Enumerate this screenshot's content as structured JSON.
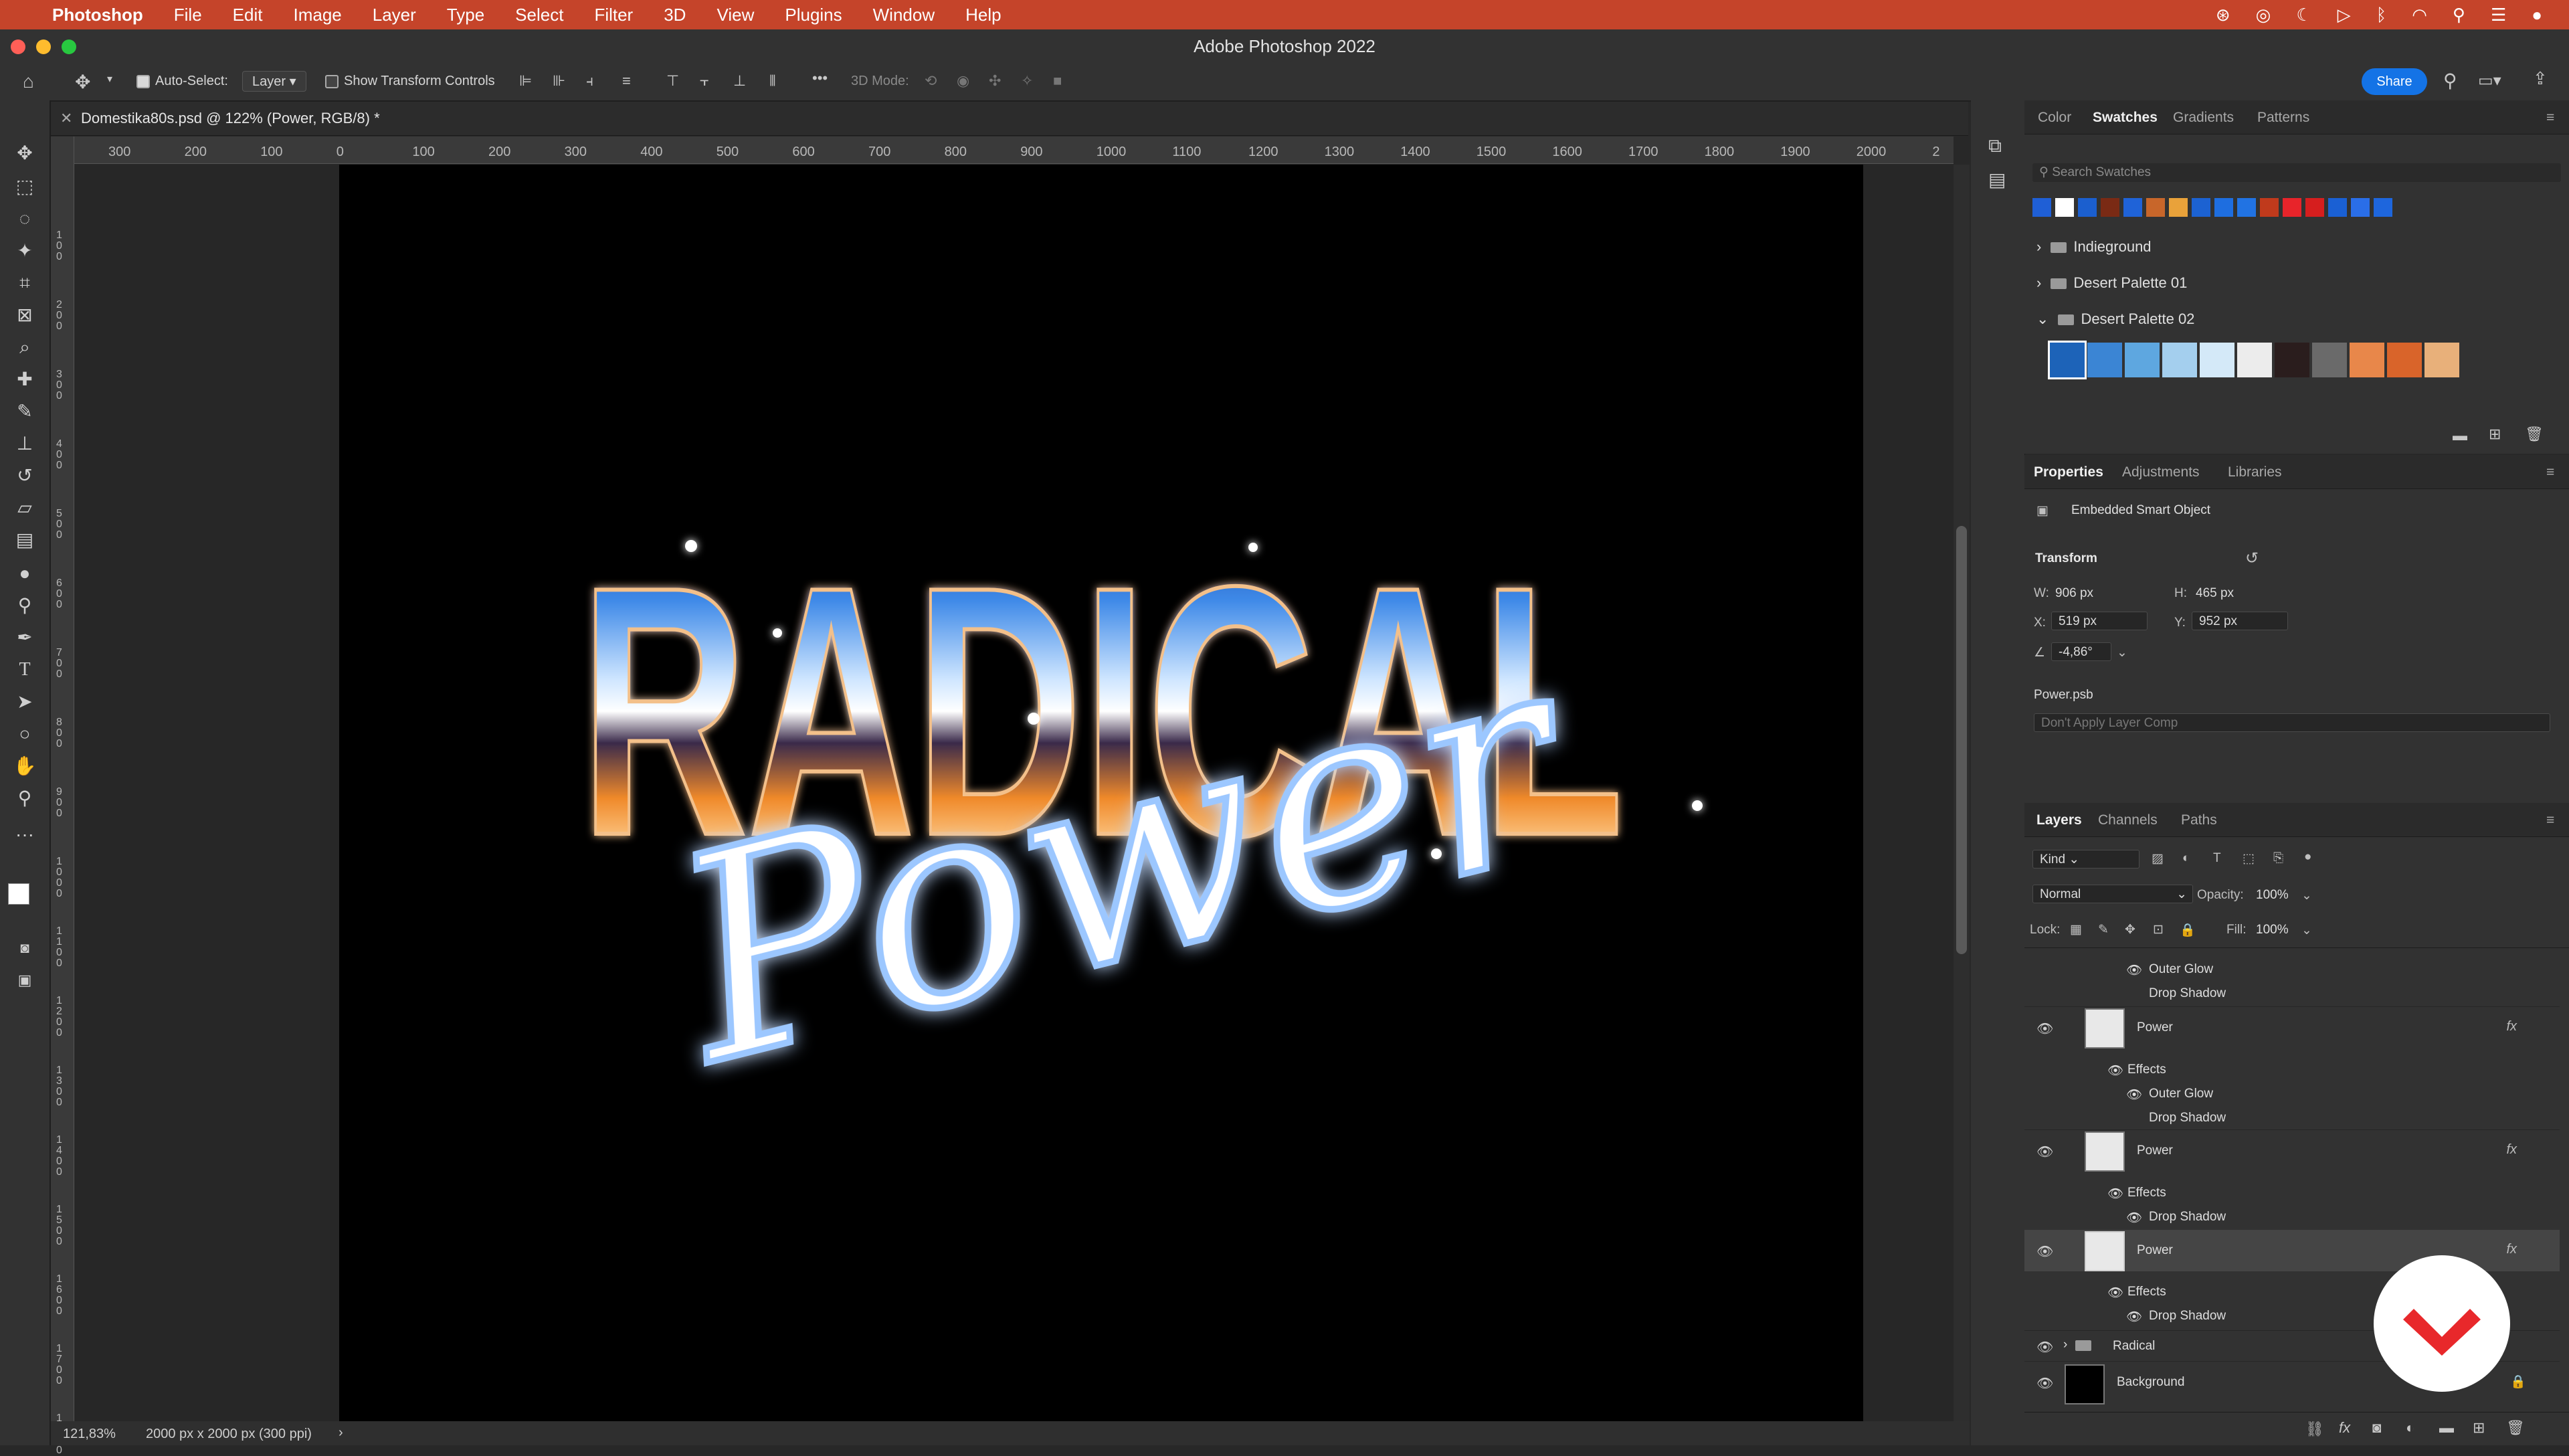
{
  "menubar": {
    "app_name": "Photoshop",
    "items": [
      "File",
      "Edit",
      "Image",
      "Layer",
      "Type",
      "Select",
      "Filter",
      "3D",
      "View",
      "Plugins",
      "Window",
      "Help"
    ]
  },
  "window": {
    "title": "Adobe Photoshop 2022"
  },
  "options_bar": {
    "auto_select_label": "Auto-Select:",
    "auto_select_value": "Layer",
    "transform_label": "Show Transform Controls",
    "mode_label": "3D Mode:",
    "share_label": "Share"
  },
  "document": {
    "tab_title": "Domestika80s.psd @ 122% (Power, RGB/8) *",
    "zoom": "121,83%",
    "doc_info": "2000 px x 2000 px (300 ppi)"
  },
  "rulers": {
    "horizontal": [
      "300",
      "200",
      "100",
      "0",
      "100",
      "200",
      "300",
      "400",
      "500",
      "600",
      "700",
      "800",
      "900",
      "1000",
      "1100",
      "1200",
      "1300",
      "1400",
      "1500",
      "1600",
      "1700",
      "1800",
      "1900",
      "2000",
      "2"
    ],
    "vertical": [
      "1\n0\n0",
      "2\n0\n0",
      "3\n0\n0",
      "4\n0\n0",
      "5\n0\n0",
      "6\n0\n0",
      "7\n0\n0",
      "8\n0\n0",
      "9\n0\n0",
      "1\n0\n0\n0",
      "1\n1\n0\n0",
      "1\n2\n0\n0",
      "1\n3\n0\n0",
      "1\n4\n0\n0",
      "1\n5\n0\n0",
      "1\n6\n0\n0",
      "1\n7\n0\n0",
      "1\n8\n0\n0"
    ]
  },
  "artwork": {
    "title_text": "RADICAL",
    "script_text": "Power"
  },
  "swatches_panel": {
    "tabs": [
      "Color",
      "Swatches",
      "Gradients",
      "Patterns"
    ],
    "active_tab": "Swatches",
    "search_placeholder": "Search Swatches",
    "recent_colors": [
      "#1f5fd6",
      "#ffffff",
      "#1b5fcf",
      "#7a2a14",
      "#1f63d8",
      "#c8662a",
      "#e9a23a",
      "#1c62d2",
      "#1e6ee0",
      "#2173e3",
      "#c03a1c",
      "#e8242a",
      "#d61e1e",
      "#1a60d4",
      "#2a6ee8",
      "#1e66dd"
    ],
    "folders": [
      {
        "name": "Indieground",
        "expanded": false
      },
      {
        "name": "Desert Palette 01",
        "expanded": false
      },
      {
        "name": "Desert Palette 02",
        "expanded": true
      }
    ],
    "desert_palette_02": [
      "#1d63b8",
      "#3b85d4",
      "#5ea7e0",
      "#a4cfee",
      "#d4e9f8",
      "#ececec",
      "#2a1d1d",
      "#6a6a6a",
      "#e8874a",
      "#d9642a",
      "#e8b07a"
    ]
  },
  "properties_panel": {
    "tabs": [
      "Properties",
      "Adjustments",
      "Libraries"
    ],
    "active_tab": "Properties",
    "object_type": "Embedded Smart Object",
    "section": "Transform",
    "w_label": "W:",
    "w_value": "906 px",
    "h_label": "H:",
    "h_value": "465 px",
    "x_label": "X:",
    "x_value": "519 px",
    "y_label": "Y:",
    "y_value": "952 px",
    "angle_value": "-4,86°",
    "filename": "Power.psb",
    "layer_comp_placeholder": "Don't Apply Layer Comp"
  },
  "layers_panel": {
    "tabs": [
      "Layers",
      "Channels",
      "Paths"
    ],
    "active_tab": "Layers",
    "filter_kind": "Kind",
    "blend_mode": "Normal",
    "opacity_label": "Opacity:",
    "opacity_value": "100%",
    "lock_label": "Lock:",
    "fill_label": "Fill:",
    "fill_value": "100%",
    "top_effects": [
      "Outer Glow",
      "Drop Shadow"
    ],
    "layers": [
      {
        "name": "Power",
        "effects_label": "Effects",
        "effects": [
          "Outer Glow",
          "Drop Shadow"
        ],
        "selected": false
      },
      {
        "name": "Power",
        "effects_label": "Effects",
        "effects": [
          "Drop Shadow"
        ],
        "selected": false
      },
      {
        "name": "Power",
        "effects_label": "Effects",
        "effects": [
          "Drop Shadow"
        ],
        "selected": true
      }
    ],
    "group_name": "Radical",
    "background_name": "Background",
    "fx_label": "fx"
  }
}
